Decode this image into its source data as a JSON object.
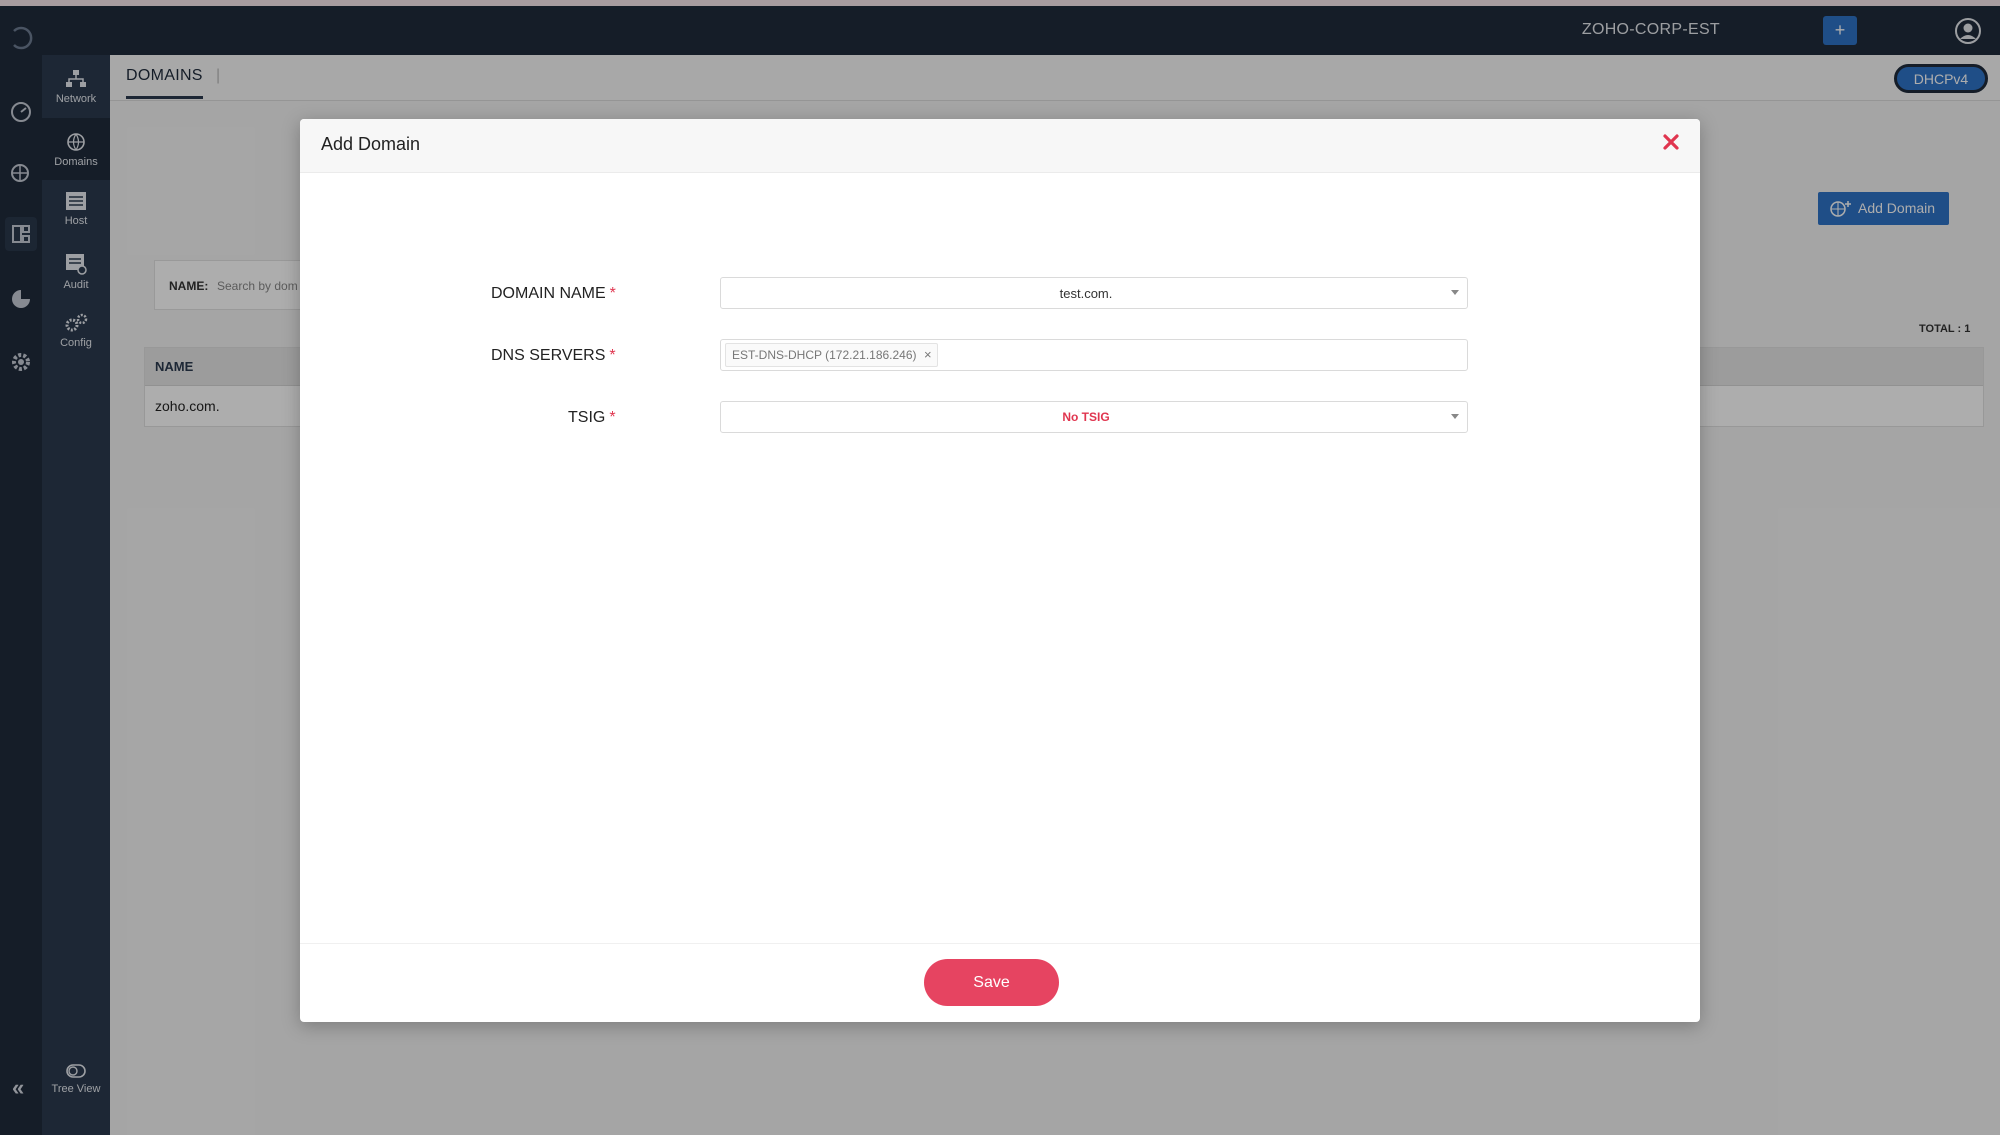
{
  "topbar": {
    "org_name": "ZOHO-CORP-EST",
    "plus_label": "+"
  },
  "subnav": {
    "items": [
      {
        "label": "Network",
        "icon": "network-icon"
      },
      {
        "label": "Domains",
        "icon": "globe-icon"
      },
      {
        "label": "Host",
        "icon": "host-icon"
      },
      {
        "label": "Audit",
        "icon": "audit-icon"
      },
      {
        "label": "Config",
        "icon": "config-icon"
      }
    ],
    "tree_view_label": "Tree View"
  },
  "rail": {
    "collapse_label": "«"
  },
  "tabs": {
    "domains_label": "DOMAINS",
    "separator": "|",
    "protocol_toggle": "DHCPv4"
  },
  "page": {
    "add_domain_label": "Add Domain",
    "filter_label": "NAME:",
    "filter_placeholder": "Search by dom",
    "total_label": "TOTAL : 1",
    "table": {
      "columns": [
        "NAME"
      ],
      "rows": [
        [
          "zoho.com."
        ]
      ]
    }
  },
  "modal": {
    "title": "Add Domain",
    "close_glyph": "✕",
    "fields": {
      "domain_name": {
        "label": "DOMAIN NAME",
        "required": "*",
        "value": "test.com."
      },
      "dns_servers": {
        "label": "DNS SERVERS",
        "required": "*",
        "chips": [
          "EST-DNS-DHCP (172.21.186.246)"
        ],
        "chip_remove": "×"
      },
      "tsig": {
        "label": "TSIG",
        "required": "*",
        "value": "No TSIG"
      }
    },
    "save_label": "Save"
  },
  "colors": {
    "sidebar": "#1f2b3c",
    "subnav": "#2b3a4f",
    "primary": "#2f74c8",
    "accent": "#e64461",
    "required": "#e0354f"
  }
}
